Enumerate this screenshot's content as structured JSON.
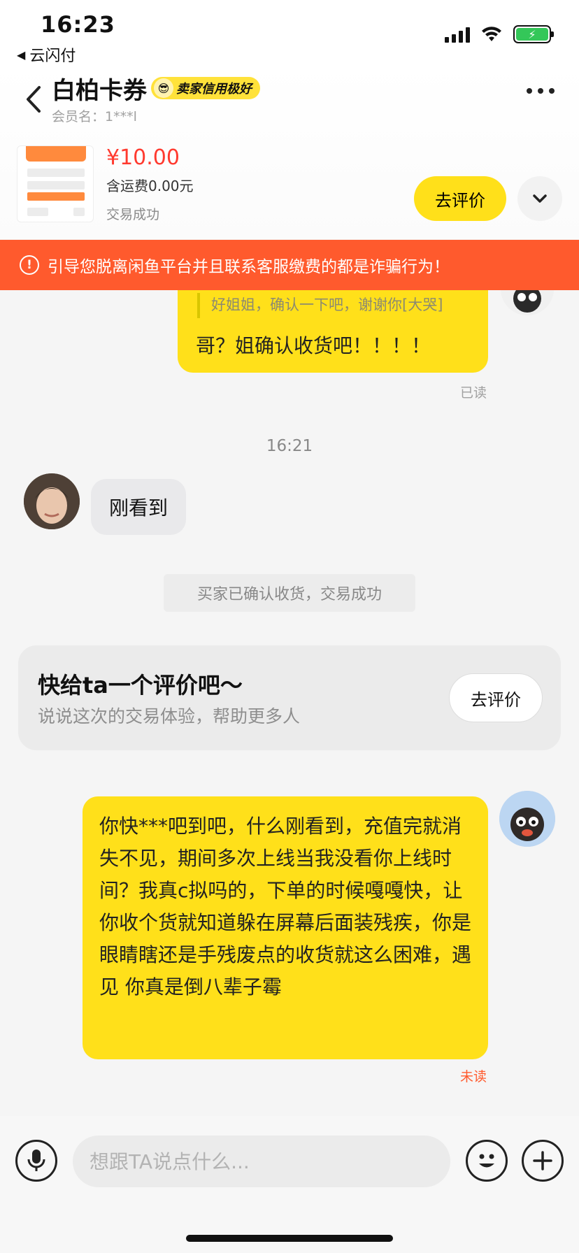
{
  "status_bar": {
    "time": "16:23",
    "back_app": "云闪付"
  },
  "header": {
    "shop_title": "白柏卡券",
    "credit_badge": "卖家信用极好",
    "member_line": "会员名：1***l"
  },
  "product": {
    "price": "¥10.00",
    "shipping": "含运费0.00元",
    "trade_status": "交易成功",
    "review_button": "去评价"
  },
  "warning": {
    "icon": "!",
    "text": "引导您脱离闲鱼平台并且联系客服缴费的都是诈骗行为！"
  },
  "chat": {
    "quote_text": "好姐姐，确认一下吧，谢谢你[大哭]",
    "my_message_1": "哥？姐确认收货吧！！！！",
    "read_status": "已读",
    "timestamp": "16:21",
    "other_message": "刚看到",
    "system_note": "买家已确认收货，交易成功",
    "rate_card": {
      "title": "快给ta一个评价吧～",
      "subtitle": "说说这次的交易体验，帮助更多人",
      "button": "去评价"
    },
    "my_message_2": "你快***吧到吧，什么刚看到，充值完就消失不见，期间多次上线当我没看你上线时间？我真c拟吗的，下单的时候嘎嘎快，让你收个货就知道躲在屏幕后面装残疾，你是眼睛瞎还是手残废点的收货就这么困难，遇见 你真是倒八辈子霉",
    "unread_status": "未读"
  },
  "input_bar": {
    "placeholder": "想跟TA说点什么..."
  },
  "icons": {
    "back": "chevron-left-icon",
    "more": "more-dots-icon",
    "expand": "chevron-down-icon",
    "warning": "exclamation-circle-icon",
    "mic": "microphone-icon",
    "emoji": "smiley-icon",
    "plus": "plus-icon"
  },
  "colors": {
    "accent_yellow": "#ffe01a",
    "warning_red": "#ff5a2d",
    "price_red": "#ff3a2f"
  }
}
